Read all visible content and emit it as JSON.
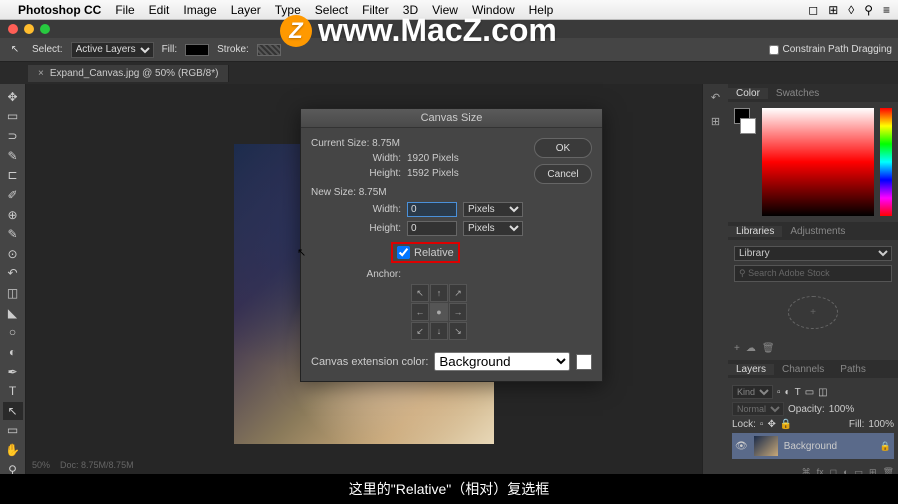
{
  "menubar": {
    "app": "Photoshop CC",
    "items": [
      "File",
      "Edit",
      "Image",
      "Layer",
      "Type",
      "Select",
      "Filter",
      "3D",
      "View",
      "Window",
      "Help"
    ]
  },
  "watermark": {
    "text": "www.MacZ.com"
  },
  "options_bar": {
    "select_label": "Select:",
    "select_value": "Active Layers",
    "fill_label": "Fill:",
    "stroke_label": "Stroke:",
    "constrain": "Constrain Path Dragging"
  },
  "doc_tab": {
    "title": "Expand_Canvas.jpg @ 50% (RGB/8*)"
  },
  "dialog": {
    "title": "Canvas Size",
    "current_label": "Current Size: 8.75M",
    "current_width_label": "Width:",
    "current_width_value": "1920 Pixels",
    "current_height_label": "Height:",
    "current_height_value": "1592 Pixels",
    "new_label": "New Size: 8.75M",
    "new_width_label": "Width:",
    "new_width_value": "0",
    "new_height_label": "Height:",
    "new_height_value": "0",
    "unit": "Pixels",
    "relative_label": "Relative",
    "anchor_label": "Anchor:",
    "ext_label": "Canvas extension color:",
    "ext_value": "Background",
    "ok": "OK",
    "cancel": "Cancel"
  },
  "panels": {
    "color_tab": "Color",
    "swatches_tab": "Swatches",
    "libraries_tab": "Libraries",
    "adjustments_tab": "Adjustments",
    "library_select": "Library",
    "search_placeholder": "Search Adobe Stock",
    "layers_tab": "Layers",
    "channels_tab": "Channels",
    "paths_tab": "Paths",
    "kind_label": "Kind",
    "blend_mode": "Normal",
    "opacity_label": "Opacity:",
    "opacity_value": "100%",
    "lock_label": "Lock:",
    "fill_label": "Fill:",
    "fill_value": "100%",
    "layer_name": "Background"
  },
  "statusbar": {
    "zoom": "50%",
    "doc": "Doc: 8.75M/8.75M"
  },
  "subtitle": {
    "text": "这里的\"Relative\"（相对）复选框"
  }
}
